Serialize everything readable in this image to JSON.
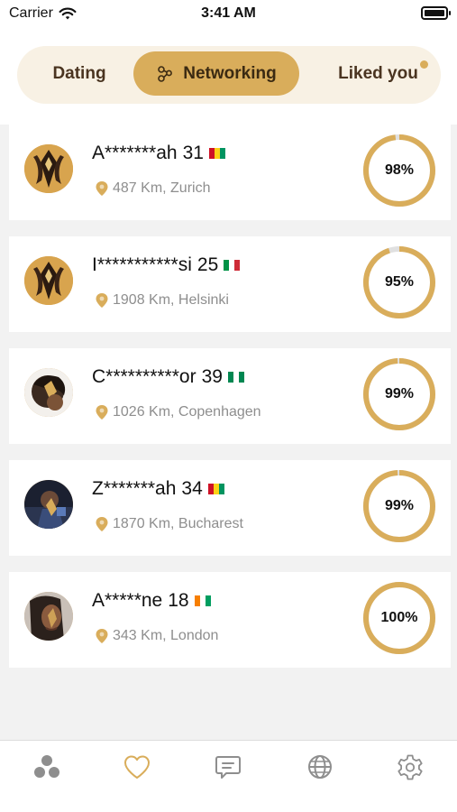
{
  "status_bar": {
    "carrier": "Carrier",
    "time": "3:41 AM"
  },
  "tabs": {
    "dating": "Dating",
    "networking": "Networking",
    "liked_you": "Liked you",
    "active": "networking"
  },
  "colors": {
    "accent": "#d9ad5b",
    "tab_bg": "#f8f1e4",
    "ring_track": "#e0e0e0",
    "muted_text": "#8e8e8e"
  },
  "matches": [
    {
      "name": "A*******ah",
      "age": "31",
      "flag": [
        "#ce1126",
        "#fcd116",
        "#009460"
      ],
      "distance": "487 Km, Zurich",
      "match": "98%",
      "match_value": 98,
      "avatar": "gold-emblem"
    },
    {
      "name": "I***********si",
      "age": "25",
      "flag": [
        "#009246",
        "#ffffff",
        "#ce2b37"
      ],
      "distance": "1908 Km, Helsinki",
      "match": "95%",
      "match_value": 95,
      "avatar": "gold-emblem"
    },
    {
      "name": "C**********or",
      "age": "39",
      "flag": [
        "#008751",
        "#ffffff",
        "#008751"
      ],
      "distance": "1026 Km, Copenhagen",
      "match": "99%",
      "match_value": 99,
      "avatar": "photo-hair"
    },
    {
      "name": "Z*******ah",
      "age": "34",
      "flag": [
        "#ce1126",
        "#fcd116",
        "#009460"
      ],
      "distance": "1870 Km, Bucharest",
      "match": "99%",
      "match_value": 99,
      "avatar": "photo-night"
    },
    {
      "name": "A*****ne",
      "age": "18",
      "flag": [
        "#f77f00",
        "#ffffff",
        "#009e60"
      ],
      "distance": "343 Km, London",
      "match": "100%",
      "match_value": 100,
      "avatar": "photo-portrait"
    }
  ],
  "bottom_nav": [
    {
      "icon": "people-icon",
      "active": false
    },
    {
      "icon": "heart-icon",
      "active": true
    },
    {
      "icon": "chat-icon",
      "active": false
    },
    {
      "icon": "globe-icon",
      "active": false
    },
    {
      "icon": "settings-icon",
      "active": false
    }
  ]
}
